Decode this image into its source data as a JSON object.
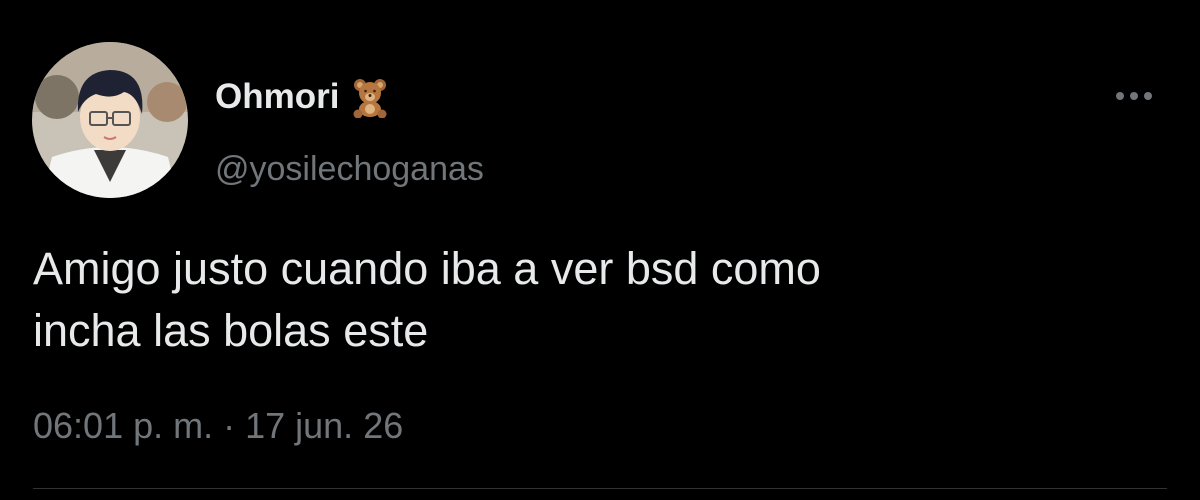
{
  "tweet": {
    "author": {
      "display_name": "Ohmori",
      "name_emoji": "teddy-bear-icon",
      "handle": "@yosilechoganas"
    },
    "text": "Amigo justo cuando iba a ver bsd como\nincha las bolas este",
    "timestamp": "06:01 p. m. · 17 jun. 26",
    "more_icon": "more-horizontal-icon"
  },
  "colors": {
    "background": "#000000",
    "primary_text": "#e7e9ea",
    "secondary_text": "#71767b",
    "divider": "#2f3336"
  }
}
